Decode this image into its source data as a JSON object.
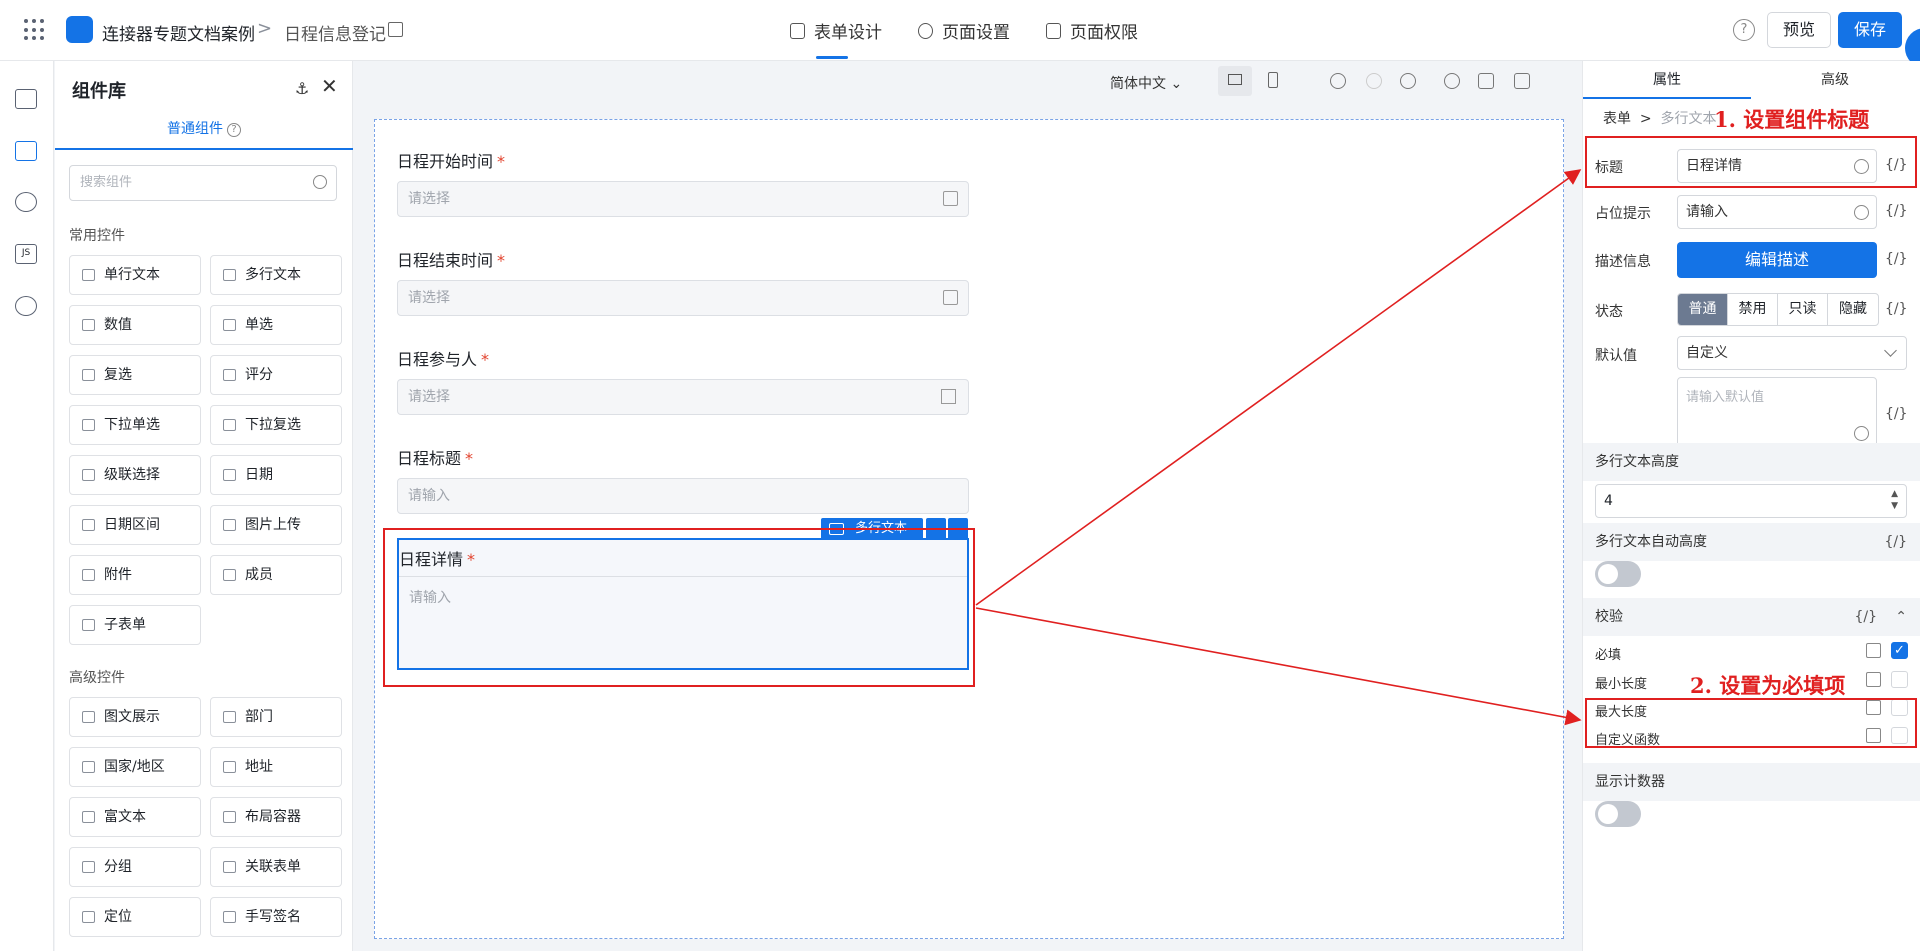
{
  "header": {
    "app_name": "连接器专题文档案例",
    "crumb_sep": ">",
    "page_name": "日程信息登记",
    "tabs": [
      {
        "label": "表单设计",
        "icon": "document-icon"
      },
      {
        "label": "页面设置",
        "icon": "gear-icon"
      },
      {
        "label": "页面权限",
        "icon": "lock-icon"
      }
    ],
    "help": "?",
    "preview": "预览",
    "save": "保存",
    "accent": "#1473e6"
  },
  "component_panel": {
    "title": "组件库",
    "tab": "普通组件",
    "search_placeholder": "搜索组件",
    "common_title": "常用控件",
    "common_items": [
      "单行文本",
      "多行文本",
      "数值",
      "单选",
      "复选",
      "评分",
      "下拉单选",
      "下拉复选",
      "级联选择",
      "日期",
      "日期区间",
      "图片上传",
      "附件",
      "成员",
      "子表单"
    ],
    "advanced_title": "高级控件",
    "advanced_items": [
      "图文展示",
      "部门",
      "国家/地区",
      "地址",
      "富文本",
      "布局容器",
      "分组",
      "关联表单",
      "定位",
      "手写签名"
    ]
  },
  "designer": {
    "language": "简体中文",
    "fields": [
      {
        "label": "日程开始时间",
        "placeholder": "请选择",
        "required": "*"
      },
      {
        "label": "日程结束时间",
        "placeholder": "请选择",
        "required": "*"
      },
      {
        "label": "日程参与人",
        "placeholder": "请选择",
        "required": "*"
      },
      {
        "label": "日程标题",
        "placeholder": "请输入",
        "required": "*"
      }
    ],
    "selected_field": {
      "label": "日程详情",
      "placeholder": "请输入",
      "required": "*",
      "type_badge": "多行文本"
    }
  },
  "props": {
    "tabs": [
      "属性",
      "高级"
    ],
    "crumb": [
      "表单",
      "多行文本"
    ],
    "title_label": "标题",
    "title_value": "日程详情",
    "placeholder_label": "占位提示",
    "placeholder_value": "请输入",
    "desc_label": "描述信息",
    "desc_button": "编辑描述",
    "state_label": "状态",
    "state_options": [
      "普通",
      "禁用",
      "只读",
      "隐藏"
    ],
    "state_selected": "普通",
    "default_label": "默认值",
    "default_mode": "自定义",
    "default_placeholder": "请输入默认值",
    "var": "{/}",
    "height_section": "多行文本高度",
    "height_value": "4",
    "auto_height_section": "多行文本自动高度",
    "validation_section": "校验",
    "rules": [
      {
        "label": "必填",
        "checked": true
      },
      {
        "label": "最小长度",
        "checked": false
      },
      {
        "label": "最大长度",
        "checked": false
      },
      {
        "label": "自定义函数",
        "checked": false
      }
    ],
    "counter_section": "显示计数器"
  },
  "annotations": {
    "step1": "1. 设置组件标题",
    "step2": "2. 设置为必填项",
    "color": "#e02020"
  }
}
